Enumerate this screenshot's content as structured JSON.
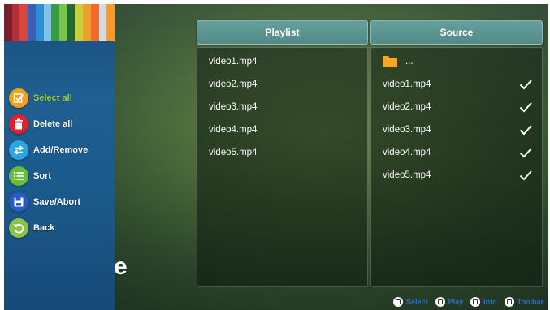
{
  "side_menu": {
    "items": [
      {
        "label": "Select all",
        "icon": "check-icon",
        "color": "#f3a11a",
        "selected": true
      },
      {
        "label": "Delete all",
        "icon": "trash-icon",
        "color": "#e22028"
      },
      {
        "label": "Add/Remove",
        "icon": "swap-arrows-icon",
        "color": "#2ca5e4"
      },
      {
        "label": "Sort",
        "icon": "list-icon",
        "color": "#6cbc3c"
      },
      {
        "label": "Save/Abort",
        "icon": "save-icon",
        "color": "#2a59c4"
      },
      {
        "label": "Back",
        "icon": "back-arrow-icon",
        "color": "#8cc24a"
      }
    ],
    "banner_colors": [
      "#7c1f2a",
      "#b52f3a",
      "#d8463f",
      "#3a5fb0",
      "#2a8fd6",
      "#7fc3e8",
      "#3a9b45",
      "#7bc44b",
      "#1f6a3a",
      "#c7d23b",
      "#e8a12b",
      "#f06a2a",
      "#d9d9d9",
      "#ff9a2a"
    ]
  },
  "background_title": "ose",
  "playlist": {
    "header": "Playlist",
    "items": [
      "video1.mp4",
      "video2.mp4",
      "video3.mp4",
      "video4.mp4",
      "video5.mp4"
    ]
  },
  "source": {
    "header": "Source",
    "folder_label": "...",
    "items": [
      "video1.mp4",
      "video2.mp4",
      "video3.mp4",
      "video4.mp4",
      "video5.mp4"
    ]
  },
  "footer": {
    "hints": [
      {
        "label": "Select",
        "icon": "select-key-icon"
      },
      {
        "label": "Play",
        "icon": "play-key-icon"
      },
      {
        "label": "Info",
        "icon": "info-key-icon"
      },
      {
        "label": "Toolbar",
        "icon": "toolbar-key-icon"
      }
    ]
  },
  "colors": {
    "header_bg": "#5a9593",
    "accent_selected": "#9ad24a",
    "footer_text": "#2e6cc5"
  }
}
